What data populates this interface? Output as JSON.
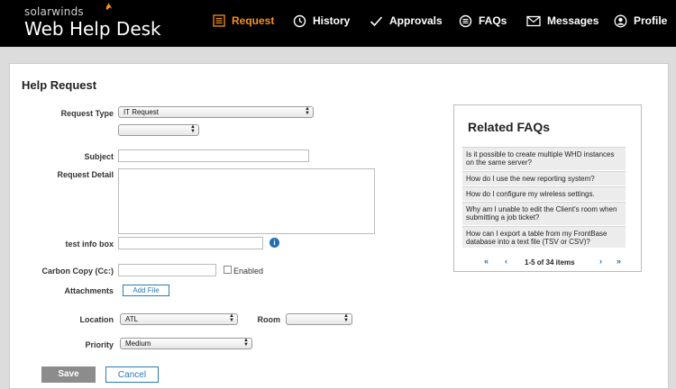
{
  "header": {
    "brand": "solarwinds",
    "product": "Web Help Desk",
    "nav": [
      {
        "label": "Request",
        "icon": "list-icon",
        "active": true
      },
      {
        "label": "History",
        "icon": "clock-icon"
      },
      {
        "label": "Approvals",
        "icon": "checkmark-icon"
      },
      {
        "label": "FAQs",
        "icon": "list-circle-icon"
      },
      {
        "label": "Messages",
        "icon": "envelope-icon"
      },
      {
        "label": "Profile",
        "icon": "user-icon"
      }
    ],
    "accent_color": "#f5901e"
  },
  "form": {
    "title": "Help Request",
    "request_type_label": "Request Type",
    "request_type_value": "IT Request",
    "subtype_value": "",
    "subject_label": "Subject",
    "subject_value": "",
    "request_detail_label": "Request Detail",
    "request_detail_value": "",
    "test_info_label": "test info box",
    "test_info_value": "",
    "cc_label": "Carbon Copy (Cc:)",
    "cc_value": "",
    "enabled_label": "Enabled",
    "attachments_label": "Attachments",
    "add_file_label": "Add File",
    "location_label": "Location",
    "location_value": "ATL",
    "room_label": "Room",
    "room_value": "",
    "priority_label": "Priority",
    "priority_value": "Medium",
    "save_label": "Save",
    "cancel_label": "Cancel"
  },
  "faqs": {
    "title": "Related FAQs",
    "items": [
      "Is it possible to create multiple WHD instances on the same server?",
      "How do I use the new reporting system?",
      "How do I configure my wireless settings.",
      "Why am I unable to edit the Client's room when submitting a job ticket?",
      "How can I export a table from my FrontBase database into a text file (TSV or CSV)?"
    ],
    "pager_text": "1-5 of 34 items"
  }
}
